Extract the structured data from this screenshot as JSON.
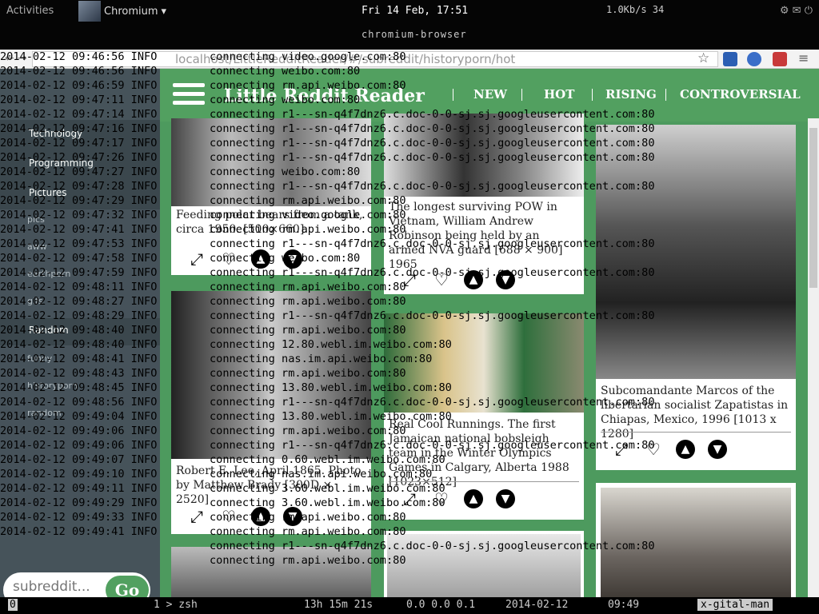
{
  "topbar": {
    "activities": "Activities",
    "user": "Chromium",
    "clock": "Fri 14 Feb, 17:51",
    "net": "1.0Kb/s  34",
    "status": "chromium-browser"
  },
  "browser": {
    "url": "localhost/LittleRedditReader/#/subreddit/historyporn/hot",
    "url_prefix": "file:///home/user/",
    "back": "←",
    "fwd": "→",
    "reload": "⟳",
    "star": "☆",
    "menu": "≡"
  },
  "site": {
    "title": "Little Reddit Reader",
    "tabs": [
      "NEW",
      "HOT",
      "RISING",
      "CONTROVERSIAL"
    ]
  },
  "sidebar": {
    "items": [
      "Technology",
      "Programming",
      "Pictures"
    ],
    "subs": [
      "pics",
      "aww",
      "earthporn",
      "gifs"
    ],
    "random_label": "Random",
    "subs2": [
      "funny",
      "historyporn",
      "random"
    ],
    "input_placeholder": "subreddit...",
    "go": "Go"
  },
  "cards": [
    {
      "caption": "Feeding polar bears from a tank, circa 1950. [500×660]"
    },
    {
      "caption": "Robert E. Lee, April 1865. Photo by Matthew Brady [300D × 2520]"
    },
    {
      "caption": "The longest surviving POW in Vietnam, William Andrew Robinson being held by an armed NVA guard [688 × 900] 1965"
    },
    {
      "caption": "Real Cool Runnings. The first Jamaican national bobsleigh team in the Winter Olympics Games in Calgary, Alberta 1988 [1023×512]"
    },
    {
      "caption": "Subcomandante Marcos of the libertarian socialist Zapatistas in Chiapas, Mexico, 1996 [1013 x 1280]"
    }
  ],
  "log": {
    "date": "2014-02-12",
    "level": "INFO",
    "times": [
      "09:46:56",
      "09:46:56",
      "09:46:59",
      "09:47:11",
      "09:47:14",
      "09:47:16",
      "09:47:17",
      "09:47:26",
      "09:47:27",
      "09:47:28",
      "09:47:29",
      "09:47:32",
      "09:47:41",
      "09:47:53",
      "09:47:58",
      "09:47:59",
      "09:48:11",
      "09:48:27",
      "09:48:29",
      "09:48:40",
      "09:48:40",
      "09:48:41",
      "09:48:43",
      "09:48:45",
      "09:48:56",
      "09:49:04",
      "09:49:06",
      "09:49:06",
      "09:49:07",
      "09:49:10",
      "09:49:11",
      "09:49:29",
      "09:49:33",
      "09:49:41"
    ],
    "conns": [
      "connecting video.google.com:80",
      "connecting weibo.com:80",
      "connecting rm.api.weibo.com:80",
      "connecting weibo.com:80",
      "connecting r1---sn-q4f7dnz6.c.doc-0-0-sj.sj.googleusercontent.com:80",
      "connecting r1---sn-q4f7dnz6.c.doc-0-0-sj.sj.googleusercontent.com:80",
      "connecting r1---sn-q4f7dnz6.c.doc-0-0-sj.sj.googleusercontent.com:80",
      "connecting r1---sn-q4f7dnz6.c.doc-0-0-sj.sj.googleusercontent.com:80",
      "connecting weibo.com:80",
      "connecting r1---sn-q4f7dnz6.c.doc-0-0-sj.sj.googleusercontent.com:80",
      "connecting rm.api.weibo.com:80",
      "connecting video.google.com:80",
      "connecting rm.api.weibo.com:80",
      "connecting r1---sn-q4f7dnz6.c.doc-0-0-sj.sj.googleusercontent.com:80",
      "connecting weibo.com:80",
      "connecting r1---sn-q4f7dnz6.c.doc-0-0-sj.sj.googleusercontent.com:80",
      "connecting rm.api.weibo.com:80",
      "connecting rm.api.weibo.com:80",
      "connecting r1---sn-q4f7dnz6.c.doc-0-0-sj.sj.googleusercontent.com:80",
      "connecting rm.api.weibo.com:80",
      "connecting 12.80.webl.im.weibo.com:80",
      "connecting nas.im.api.weibo.com:80",
      "connecting rm.api.weibo.com:80",
      "connecting 13.80.webl.im.weibo.com:80",
      "connecting r1---sn-q4f7dnz6.c.doc-0-0-sj.sj.googleusercontent.com:80",
      "connecting 13.80.webl.im.weibo.com:80",
      "connecting rm.api.weibo.com:80",
      "connecting r1---sn-q4f7dnz6.c.doc-0-0-sj.sj.googleusercontent.com:80",
      "connecting 0.60.webl.im.weibo.com:80",
      "connecting nas.im.api.weibo.com:80",
      "connecting 3.60.webl.im.weibo.com:80",
      "connecting 3.60.webl.im.weibo.com:80",
      "connecting rm.api.weibo.com:80",
      "connecting rm.api.weibo.com:80",
      "connecting r1---sn-q4f7dnz6.c.doc-0-0-sj.sj.googleusercontent.com:80",
      "connecting rm.api.weibo.com:80"
    ]
  },
  "tmux": {
    "win": "0",
    "shell": "1 > zsh",
    "uptime": "13h 15m 21s",
    "load": "0.0 0.0 0.1",
    "date": "2014-02-12",
    "time": "09:49",
    "host": "x-gital-man"
  },
  "colors": {
    "green": "#52a060",
    "sidebar": "#46505a"
  }
}
